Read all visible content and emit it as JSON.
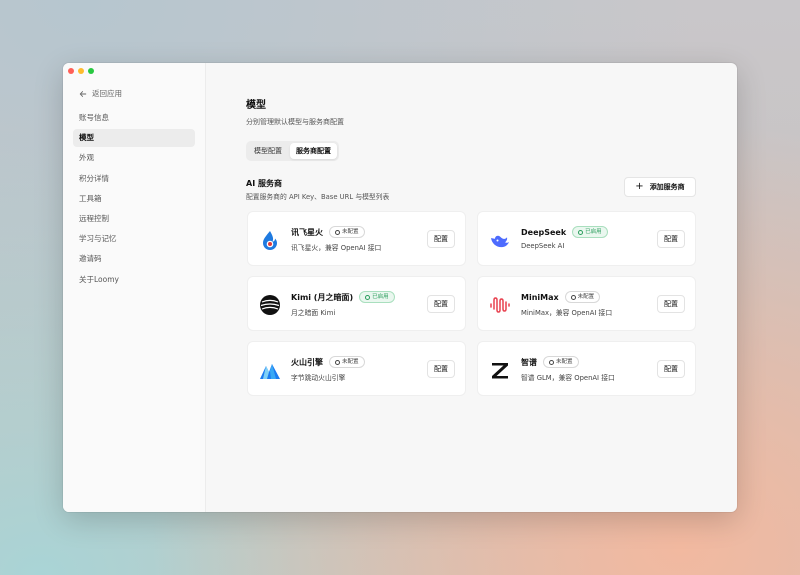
{
  "sidebar": {
    "back_label": "返回应用",
    "items": [
      {
        "label": "账号信息"
      },
      {
        "label": "模型"
      },
      {
        "label": "外观"
      },
      {
        "label": "积分详情"
      },
      {
        "label": "工具箱"
      },
      {
        "label": "远程控制"
      },
      {
        "label": "学习与记忆"
      },
      {
        "label": "邀请码"
      },
      {
        "label": "关于Loomy"
      }
    ],
    "active_index": 1
  },
  "main": {
    "title": "模型",
    "subtitle": "分别管理默认模型与服务商配置",
    "tabs": [
      {
        "label": "模型配置",
        "active": false
      },
      {
        "label": "服务商配置",
        "active": true
      }
    ],
    "section_title": "AI 服务商",
    "section_desc": "配置服务商的 API Key、Base URL 与模型列表",
    "add_button_label": "添加服务商",
    "config_label": "配置",
    "providers": [
      {
        "name": "讯飞星火",
        "desc": "讯飞星火，兼容 OpenAI 接口",
        "status": "未配置",
        "enabled": false,
        "icon": "spark-icon"
      },
      {
        "name": "DeepSeek",
        "desc": "DeepSeek AI",
        "status": "已启用",
        "enabled": true,
        "icon": "deepseek-whale-icon"
      },
      {
        "name": "Kimi (月之暗面)",
        "desc": "月之暗面 Kimi",
        "status": "已启用",
        "enabled": true,
        "icon": "kimi-icon"
      },
      {
        "name": "MiniMax",
        "desc": "MiniMax，兼容 OpenAI 接口",
        "status": "未配置",
        "enabled": false,
        "icon": "minimax-icon"
      },
      {
        "name": "火山引擎",
        "desc": "字节跳动火山引擎",
        "status": "未配置",
        "enabled": false,
        "icon": "volcano-icon"
      },
      {
        "name": "智谱",
        "desc": "智谱 GLM，兼容 OpenAI 接口",
        "status": "未配置",
        "enabled": false,
        "icon": "zhipu-icon"
      }
    ]
  },
  "colors": {
    "enabled_badge": "#2a9d5c",
    "deepseek_blue": "#4d6bfe",
    "minimax_red": "#e8414f"
  }
}
